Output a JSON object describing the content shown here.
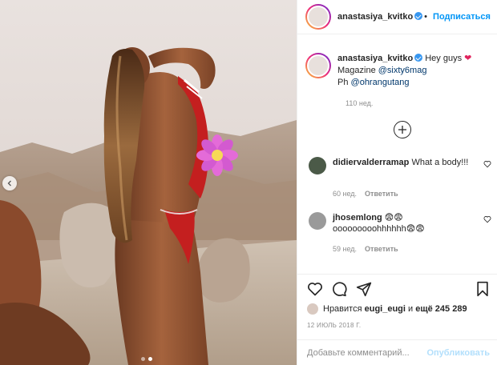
{
  "post": {
    "username": "anastasiya_kvitko",
    "verified": true,
    "follow_label": "Подписаться",
    "caption_line1": "Hey guys",
    "caption_label_magazine": "Magazine",
    "caption_mention_magazine": "@sixty6mag",
    "caption_label_ph": "Ph",
    "caption_mention_ph": "@ohrangutang",
    "caption_time": "110 нед.",
    "image_carousel": {
      "total": 2,
      "active": 2
    }
  },
  "comments": [
    {
      "username": "didiervalderramap",
      "text": "What a body!!!",
      "time": "60 нед.",
      "reply_label": "Ответить"
    },
    {
      "username": "jhosemlong",
      "text_line1": "😨😨",
      "text_line2": "ooooooooohhhhhh😨😨",
      "time": "59 нед.",
      "reply_label": "Ответить"
    }
  ],
  "likes": {
    "prefix": "Нравится",
    "user": "eugi_eugi",
    "joiner": "и",
    "others": "ещё 245 289"
  },
  "date": "12 ИЮЛЬ 2018 Г.",
  "add_comment": {
    "placeholder": "Добавьте комментарий...",
    "publish_label": "Опубликовать"
  },
  "icons": [
    "chevron-left-icon",
    "plus-icon",
    "heart-icon",
    "comment-icon",
    "share-icon",
    "bookmark-icon",
    "verified-icon",
    "flower-sticker-icon"
  ],
  "colors": {
    "accent": "#0095f6",
    "verified": "#3897f0",
    "muted": "#8e8e8e",
    "publish_disabled": "#b2dffc"
  }
}
